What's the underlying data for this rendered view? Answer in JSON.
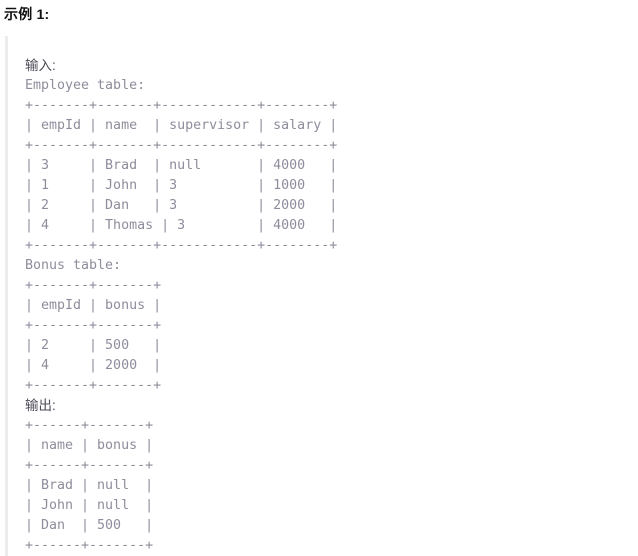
{
  "example": {
    "title": "示例 1:",
    "input_label": "输入:",
    "output_label": "输出:",
    "employee_caption": "Employee table:",
    "bonus_caption": "Bonus table:",
    "employee_table": {
      "type": "table",
      "divider": "+-------+-------+------------+--------+",
      "header": "| empId | name  | supervisor | salary |",
      "columns": [
        "empId",
        "name",
        "supervisor",
        "salary"
      ],
      "rows": [
        "| 3     | Brad  | null       | 4000   |",
        "| 1     | John  | 3          | 1000   |",
        "| 2     | Dan   | 3          | 2000   |",
        "| 4     | Thomas | 3         | 4000   |"
      ],
      "row_values": [
        [
          "3",
          "Brad",
          "null",
          "4000"
        ],
        [
          "1",
          "John",
          "3",
          "1000"
        ],
        [
          "2",
          "Dan",
          "3",
          "2000"
        ],
        [
          "4",
          "Thomas",
          "3",
          "4000"
        ]
      ]
    },
    "bonus_table": {
      "type": "table",
      "divider": "+-------+-------+",
      "header": "| empId | bonus |",
      "columns": [
        "empId",
        "bonus"
      ],
      "rows": [
        "| 2     | 500   |",
        "| 4     | 2000  |"
      ],
      "row_values": [
        [
          "2",
          "500"
        ],
        [
          "4",
          "2000"
        ]
      ]
    },
    "output_table": {
      "type": "table",
      "divider": "+------+-------+",
      "header": "| name | bonus |",
      "columns": [
        "name",
        "bonus"
      ],
      "rows": [
        "| Brad | null  |",
        "| John | null  |",
        "| Dan  | 500   |"
      ],
      "row_values": [
        [
          "Brad",
          "null"
        ],
        [
          "John",
          "null"
        ],
        [
          "Dan",
          "500"
        ]
      ]
    }
  },
  "colors": {
    "heading": "#111111",
    "code_text": "#8d8d9c",
    "label_text": "#4b4b55",
    "left_rule": "#ececec",
    "background": "#ffffff"
  }
}
